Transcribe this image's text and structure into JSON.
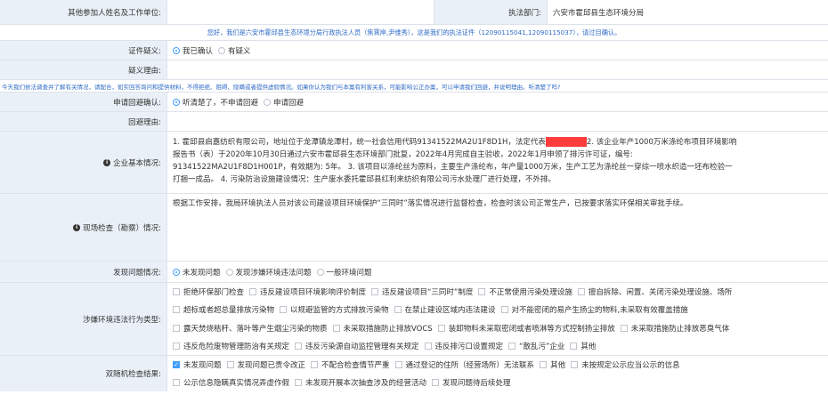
{
  "row1": {
    "label": "其他参加人姓名及工作单位:",
    "dept_label": "执法部门:",
    "dept_value": "六安市霍邱县生态环境分局"
  },
  "notice1": "您好，我们是六安市霍邱县生态环境分局行政执法人员（焦霄岸,尹维秀），这是我们的执法证件（12090115041,12090115037），请过目确认。",
  "cert": {
    "label": "证件疑义:",
    "options": [
      "我已确认",
      "有疑义"
    ]
  },
  "doubt": {
    "label": "疑义理由:"
  },
  "notice2": "今天我们依法调查并了解有关情况，请配合，如实回答询问和提供材料，不得拒绝、阻碍、隐瞒或者提供虚假情况。如果你认为我们与本案有利害关系，可能影响公正办案，可以申请我们回避，并说明理由。听清楚了吗?",
  "avoid": {
    "label": "申请回避确认:",
    "options": [
      "听清楚了，不申请回避",
      "申请回避"
    ]
  },
  "avoid_reason": {
    "label": "回避理由:"
  },
  "basic": {
    "label": "企业基本情况:",
    "line1a": "1. 霍邱县启嘉纺织有限公司，地址位于龙潭镇龙潭村，统一社会信用代码91341522MA2U1F8D1H，法定代表",
    "line1b": "2. 该企业年产1000万米涤纶布项目环境影响",
    "line2": "报告书（表）于2020年10月30日通过六安市霍邱县生态环境部门批复，2022年4月完成自主验收，2022年1月申领了排污许可证，编号:",
    "line3": "91341522MA2U1F8D1H001P，有效期为: 5年。 3. 该项目以涤纶丝为原料，主要生产涤纶布，年产量1000万米，生产工艺为涤纶丝一穿综一喷水织造一坯布检验一",
    "line4": "打捆一成品。  4. 污染防治设施建设情况：生产废水委托霍邱县红利来纺织有限公司污水处理厂进行处理，不外排。"
  },
  "site": {
    "label": "现场检查（勘察）情况:",
    "text": "根据工作安排，我局环境执法人员对该公司建设项目环境保护“三同时”落实情况进行监督检查，检查时该公司正常生产，已按要求落实环保相关审批手续。"
  },
  "found": {
    "label": "发现问题情况:",
    "options": [
      "未发现问题",
      "发现涉嫌环境违法问题",
      "一般环境问题"
    ]
  },
  "violation": {
    "label": "涉嫌环境违法行为类型:",
    "lines": [
      [
        "拒绝环保部门检查",
        "违反建设项目环境影响评价制度",
        "违反建设项目“三同时”制度",
        "不正常使用污染处理设施",
        "擅自拆除、闲置、关闭污染处理设施、场所"
      ],
      [
        "超标或者超总量排放污染物",
        "以规避监管的方式排放污染物",
        "在禁止建设区域内违法建设",
        "对不能密闭的易产生扬尘的物料,未采取有效覆盖措施"
      ],
      [
        "露天焚烧秸秆、落叶等产生烟尘污染的物质",
        "未采取措施防止排放VOCS",
        "装卸物料未采取密闭或者喷淋等方式控制扬尘排放",
        "未采取措施防止排放恶臭气体"
      ],
      [
        "违反危险废物管理防治有关规定",
        "违反污染源自动监控管理有关规定",
        "违反排污口设置规定",
        "“散乱污”企业",
        "其他"
      ]
    ]
  },
  "double": {
    "label": "双随机检查结果:",
    "lines": [
      [
        {
          "t": "未发现问题",
          "on": true
        },
        {
          "t": "发现问题已责令改正"
        },
        {
          "t": "不配合检查情节严重"
        },
        {
          "t": "通过登记的住所（经营场所）无法联系"
        },
        {
          "t": "其他"
        },
        {
          "t": "未按规定公示应当公示的信息"
        }
      ],
      [
        {
          "t": "公示信息隐瞒真实情况弄虚作假"
        },
        {
          "t": "未发现开展本次抽查涉及的经营活动"
        },
        {
          "t": "发现问题待后续处理"
        }
      ]
    ]
  }
}
